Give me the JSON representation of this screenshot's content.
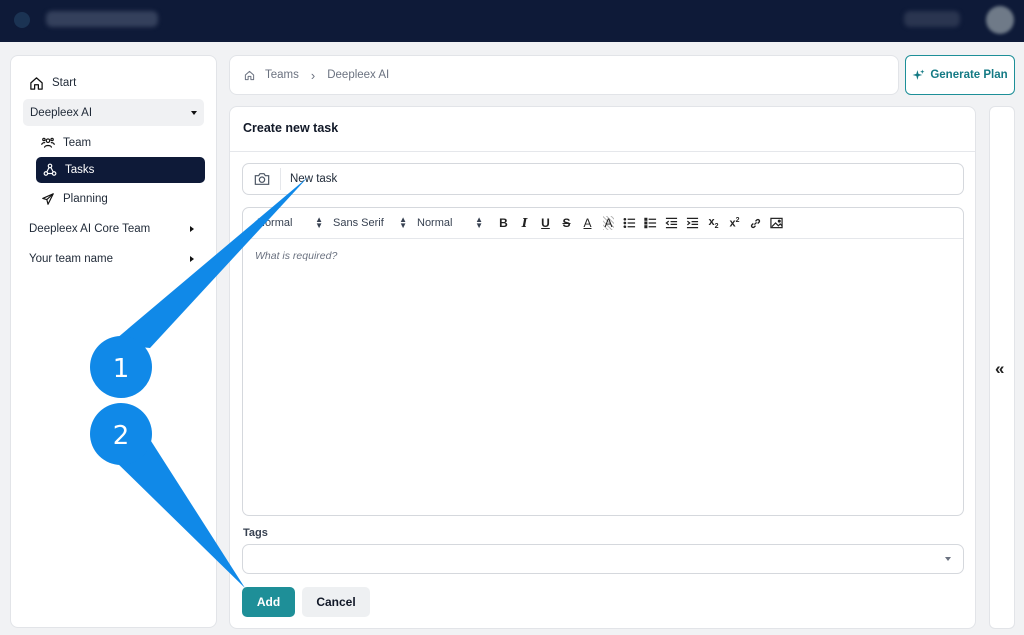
{
  "sidebar": {
    "start_label": "Start",
    "team_head_label": "Deepleex AI",
    "items": [
      {
        "label": "Team",
        "icon": "users-icon"
      },
      {
        "label": "Tasks",
        "icon": "network-icon"
      },
      {
        "label": "Planning",
        "icon": "airplane-icon"
      }
    ],
    "groups": [
      {
        "label": "Deepleex AI Core Team"
      },
      {
        "label": "Your team name"
      }
    ]
  },
  "breadcrumb": {
    "items": [
      "Teams",
      "Deepleex AI"
    ]
  },
  "generate_plan_label": "Generate Plan",
  "form": {
    "title": "Create new task",
    "task_input_value": "New task",
    "toolbar": {
      "header_select": "Normal",
      "font_select": "Sans Serif",
      "size_select": "Normal",
      "buttons": [
        "B",
        "I",
        "U",
        "S",
        "A",
        "A",
        "ol",
        "ul",
        "outdent",
        "indent",
        "x2",
        "x2",
        "link",
        "image"
      ]
    },
    "editor_placeholder": "What is required?",
    "tags_label": "Tags",
    "add_label": "Add",
    "cancel_label": "Cancel"
  },
  "collapse_label": "«",
  "annotations": [
    {
      "number": "1"
    },
    {
      "number": "2"
    }
  ],
  "colors": {
    "topbar": "#0e1a38",
    "accent": "#1e8f98",
    "annotation": "#1089e8"
  }
}
